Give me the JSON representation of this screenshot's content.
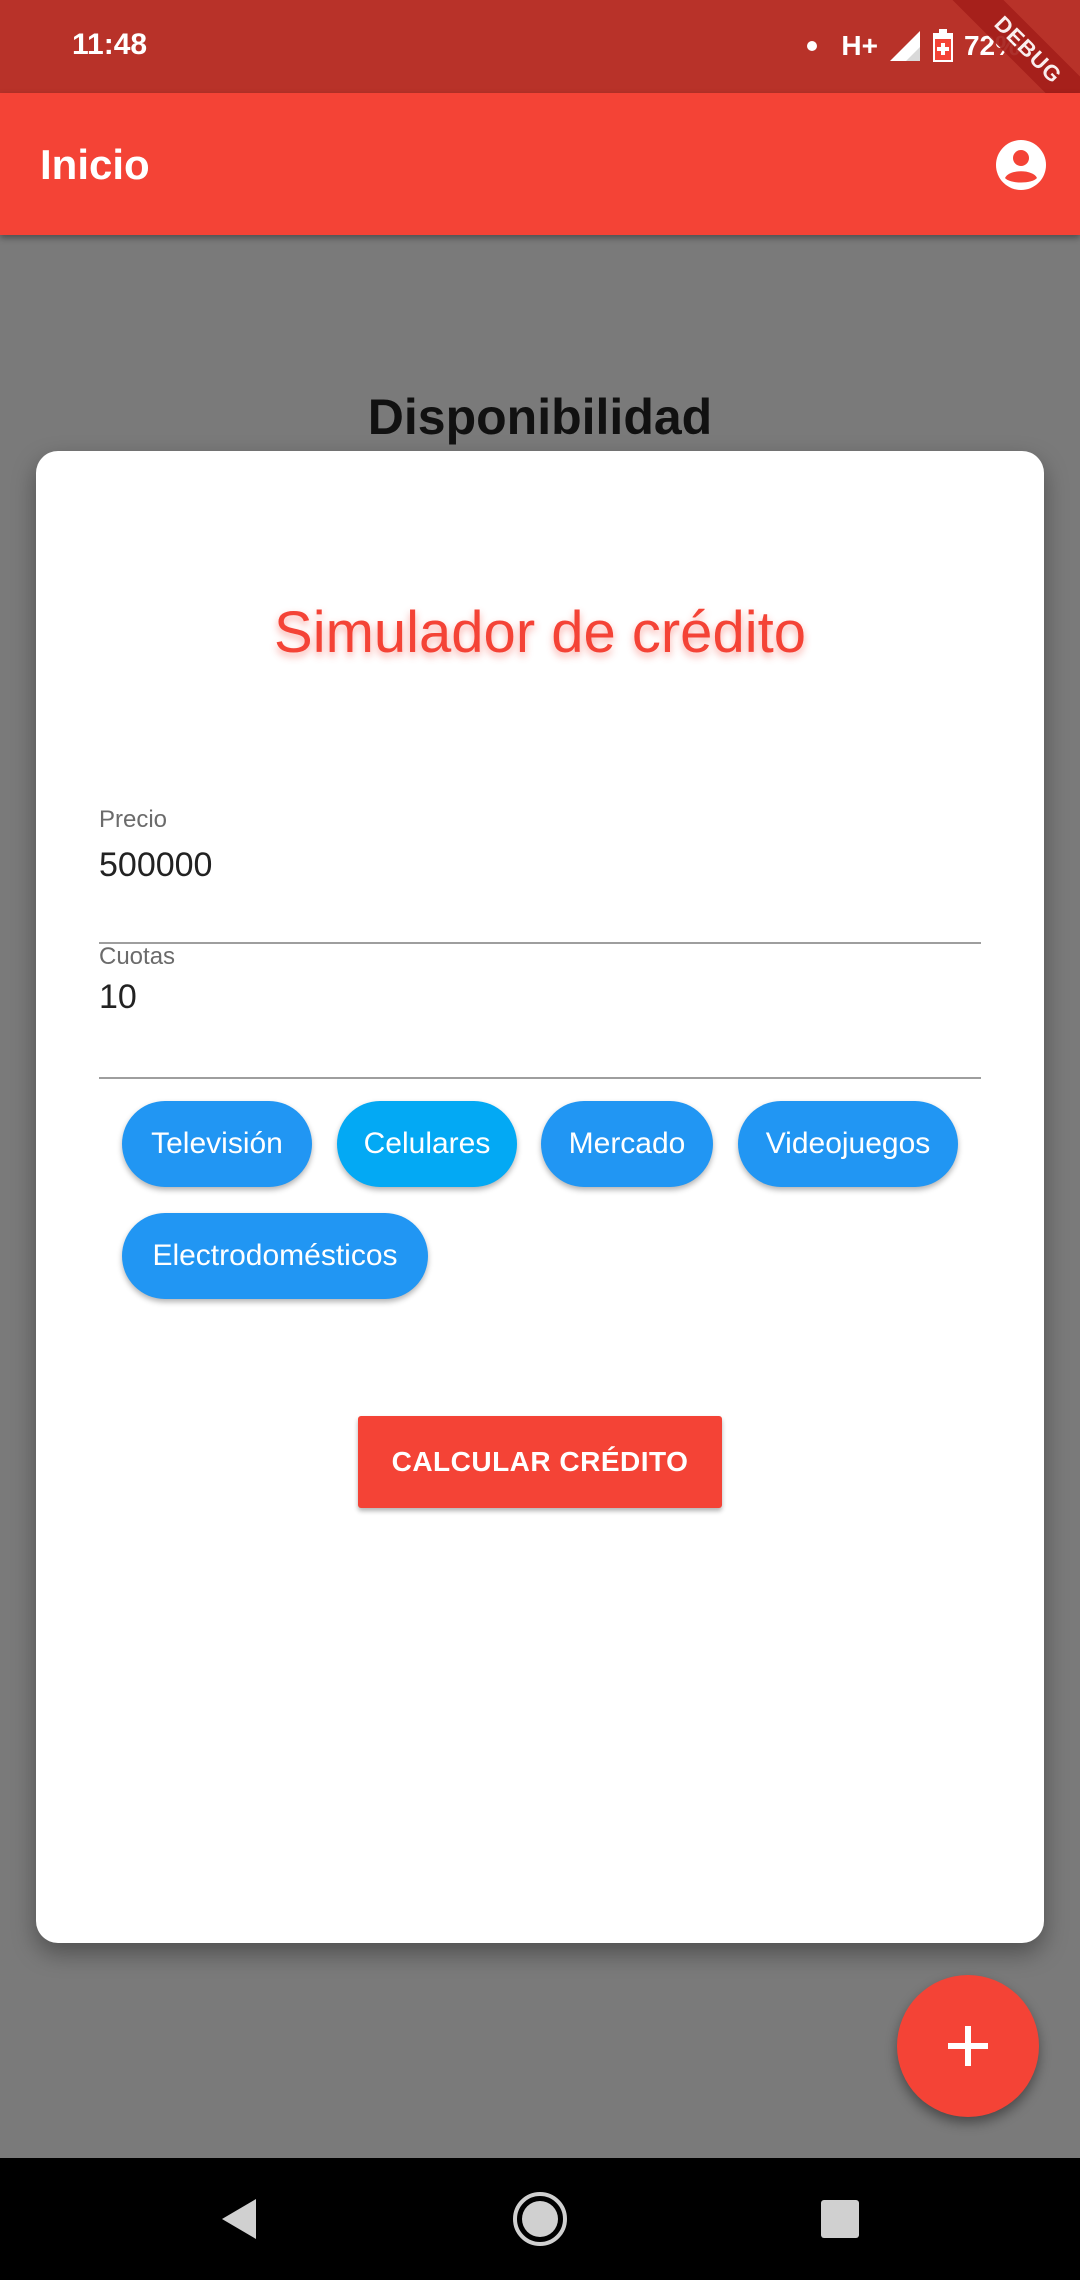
{
  "status_bar": {
    "time": "11:48",
    "network": "H+",
    "battery": "72%",
    "debug_label": "DEBUG"
  },
  "app_bar": {
    "title": "Inicio",
    "account_icon": "account-circle-icon"
  },
  "background": {
    "heading": "Disponibilidad"
  },
  "dialog": {
    "title": "Simulador de crédito",
    "fields": {
      "precio": {
        "label": "Precio",
        "value": "500000"
      },
      "cuotas": {
        "label": "Cuotas",
        "value": "10"
      }
    },
    "chips": [
      "Televisión",
      "Celulares",
      "Mercado",
      "Videojuegos",
      "Electrodomésticos"
    ],
    "selected_chip": "Celulares",
    "calculate_button": "CALCULAR CRÉDITO"
  },
  "fab": {
    "icon": "plus-icon"
  },
  "nav": {
    "back_icon": "back-icon",
    "home_icon": "home-icon",
    "recents_icon": "recents-icon"
  },
  "colors": {
    "primary": "#f44336",
    "status_bar": "#b83229",
    "chip": "#2196f3",
    "chip_selected": "#03a9f4"
  }
}
